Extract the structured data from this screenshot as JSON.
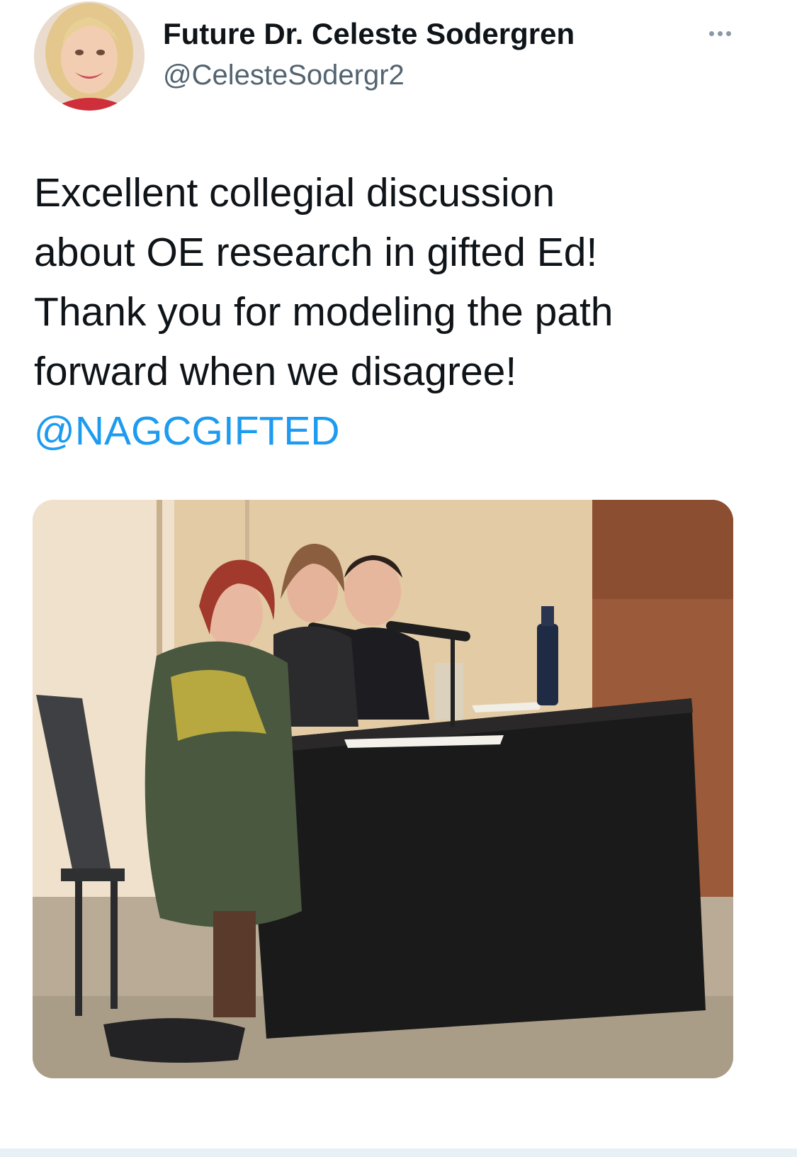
{
  "author": {
    "display_name": "Future Dr. Celeste Sodergren",
    "handle": "@CelesteSodergr2",
    "avatar_icon": "profile-photo"
  },
  "menu": {
    "icon": "more-options-icon"
  },
  "tweet": {
    "lines": [
      "Excellent collegial discussion",
      "about OE research in gifted Ed!",
      "Thank you for modeling the path",
      "forward when we disagree!"
    ],
    "mention": "@NAGCGIFTED"
  },
  "colors": {
    "text": "#0f1419",
    "secondary": "#536471",
    "link": "#1d9bf0"
  }
}
